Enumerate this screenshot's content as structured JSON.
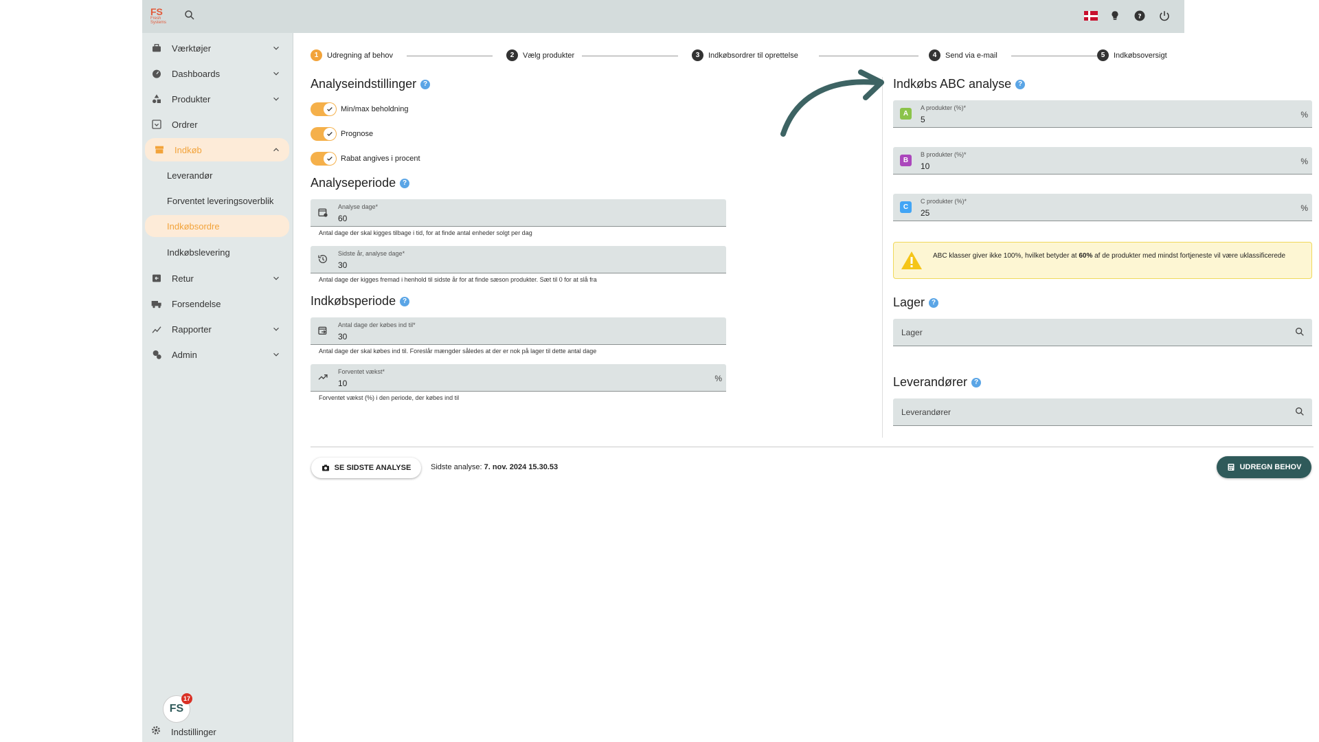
{
  "topbar": {
    "logo_text": "FS",
    "logo_sub": "Fresh Systems",
    "icons": [
      "search-icon",
      "danish-flag-icon",
      "lightbulb-icon",
      "help-icon",
      "power-icon"
    ]
  },
  "sidebar": {
    "items": [
      {
        "label": "Værktøjer",
        "icon": "toolbox-icon",
        "expandable": true
      },
      {
        "label": "Dashboards",
        "icon": "gauge-icon",
        "expandable": true
      },
      {
        "label": "Produkter",
        "icon": "shapes-icon",
        "expandable": true
      },
      {
        "label": "Ordrer",
        "icon": "inbox-icon",
        "expandable": false
      },
      {
        "label": "Indkøb",
        "icon": "store-icon",
        "expandable": true,
        "expanded": true
      },
      {
        "label": "Retur",
        "icon": "return-icon",
        "expandable": true
      },
      {
        "label": "Forsendelse",
        "icon": "truck-icon",
        "expandable": false
      },
      {
        "label": "Rapporter",
        "icon": "chart-icon",
        "expandable": true
      },
      {
        "label": "Admin",
        "icon": "admin-icon",
        "expandable": true
      }
    ],
    "sub_items": [
      {
        "label": "Leverandør"
      },
      {
        "label": "Forventet leveringsoverblik"
      },
      {
        "label": "Indkøbsordre",
        "active": true
      },
      {
        "label": "Indkøbslevering"
      }
    ],
    "settings_label": "Indstillinger",
    "badge_text": "FS",
    "badge_count": "17"
  },
  "stepper": {
    "steps": [
      {
        "num": "1",
        "label": "Udregning af behov",
        "active": true
      },
      {
        "num": "2",
        "label": "Vælg produkter"
      },
      {
        "num": "3",
        "label": "Indkøbsordrer til oprettelse"
      },
      {
        "num": "4",
        "label": "Send via e-mail"
      },
      {
        "num": "5",
        "label": "Indkøbsoversigt"
      }
    ]
  },
  "analysis_settings": {
    "title": "Analyseindstillinger",
    "toggles": [
      {
        "label": "Min/max beholdning",
        "on": true
      },
      {
        "label": "Prognose",
        "on": true
      },
      {
        "label": "Rabat angives i procent",
        "on": true
      }
    ]
  },
  "analysis_period": {
    "title": "Analyseperiode",
    "fields": [
      {
        "label": "Analyse dage*",
        "value": "60",
        "helper": "Antal dage der skal kigges tilbage i tid, for at finde antal enheder solgt per dag",
        "icon": "calendar-clock-icon"
      },
      {
        "label": "Sidste år, analyse dage*",
        "value": "30",
        "helper": "Antal dage der kigges fremad i henhold til sidste år for at finde sæson produkter. Sæt til 0 for at slå fra",
        "icon": "history-icon"
      }
    ]
  },
  "purchase_period": {
    "title": "Indkøbsperiode",
    "fields": [
      {
        "label": "Antal dage der købes ind til*",
        "value": "30",
        "helper": "Antal dage der skal købes ind til. Foreslår mængder således at der er nok på lager til dette antal dage",
        "icon": "calendar-arrow-icon"
      },
      {
        "label": "Forventet vækst*",
        "value": "10",
        "suffix": "%",
        "helper": "Forventet vækst (%) i den periode, der købes ind til",
        "icon": "trending-up-icon"
      }
    ]
  },
  "abc": {
    "title": "Indkøbs ABC analyse",
    "fields": [
      {
        "letter": "A",
        "label": "A produkter (%)*",
        "value": "5",
        "suffix": "%",
        "color": "#8bc34a"
      },
      {
        "letter": "B",
        "label": "B produkter (%)*",
        "value": "10",
        "suffix": "%",
        "color": "#ab47bc"
      },
      {
        "letter": "C",
        "label": "C produkter (%)*",
        "value": "25",
        "suffix": "%",
        "color": "#42a5f5"
      }
    ],
    "warning_pre": "ABC klasser giver ikke 100%, hvilket betyder at ",
    "warning_bold": "60%",
    "warning_post": " af de produkter med mindst fortjeneste vil være uklassificerede"
  },
  "lager": {
    "title": "Lager",
    "placeholder": "Lager"
  },
  "suppliers": {
    "title": "Leverandører",
    "placeholder": "Leverandører"
  },
  "footer": {
    "last_button": "SE SIDSTE ANALYSE",
    "last_label": "Sidste analyse:",
    "last_value": "7. nov. 2024 15.30.53",
    "calc_button": "UDREGN BEHOV"
  },
  "colors": {
    "accent": "#f2a33a",
    "primary": "#2f5a5a",
    "help": "#5aa5e6"
  }
}
